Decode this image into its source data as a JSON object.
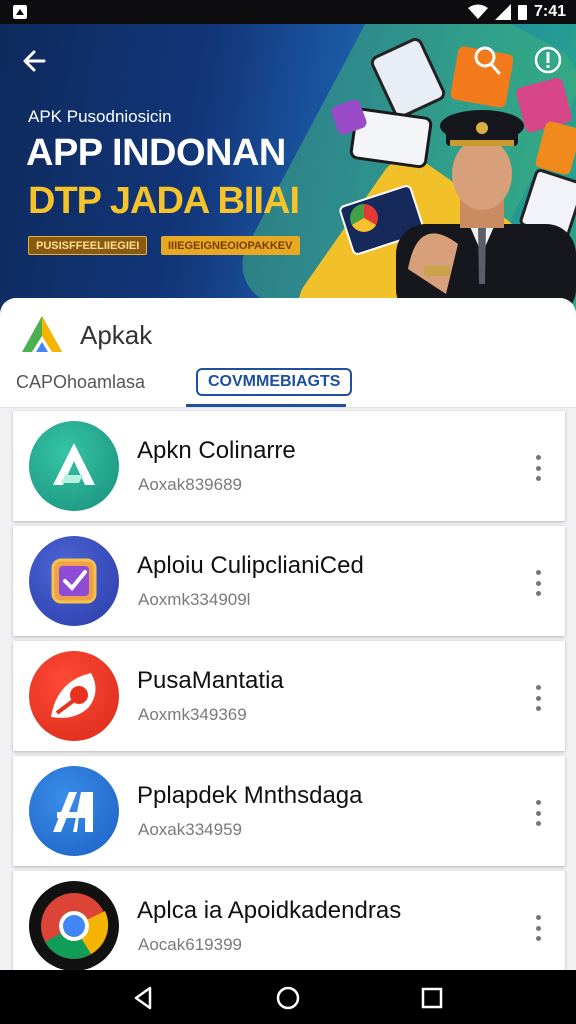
{
  "status_bar": {
    "time": "7:41"
  },
  "banner": {
    "subtitle": "APK Pusodniosicin",
    "title_line1": "APP INDONAN",
    "title_line2": "DTP JADA BIIAI",
    "pill_1": "PUSISFFEELIIEGIEI",
    "pill_2": "IIIEGEIGNEOIOPAKKEV",
    "icons": [
      "back-arrow-icon",
      "search-user-icon",
      "info-icon"
    ]
  },
  "header": {
    "brand": "Apkak"
  },
  "tabs": [
    {
      "label": "CAPOhoamlasa",
      "active": false
    },
    {
      "label": "COVMMEBIAGTS",
      "active": true
    }
  ],
  "apps": [
    {
      "name": "Apkn Colinarre",
      "sub": "Aoxak839689",
      "icon": "a-triangle-icon",
      "color": "#1f9e86"
    },
    {
      "name": "Aploiu CulipclianiCed",
      "sub": "Aoxmk334909l",
      "icon": "checklist-icon",
      "color": "#3a4db8"
    },
    {
      "name": "PusaMantatia",
      "sub": "Aoxmk349369",
      "icon": "leaf-swirl-icon",
      "color": "#e8321e"
    },
    {
      "name": "Pplapdek Mnthsdaga",
      "sub": "Aoxak334959",
      "icon": "slash-a-icon",
      "color": "#1e6fd1"
    },
    {
      "name": "Aplca ia Apoidkadendras",
      "sub": "Aocak619399",
      "icon": "chrome-icon",
      "color": "#111111"
    }
  ],
  "nav": {
    "icons": [
      "back-triangle-icon",
      "home-circle-icon",
      "recents-square-icon"
    ]
  }
}
